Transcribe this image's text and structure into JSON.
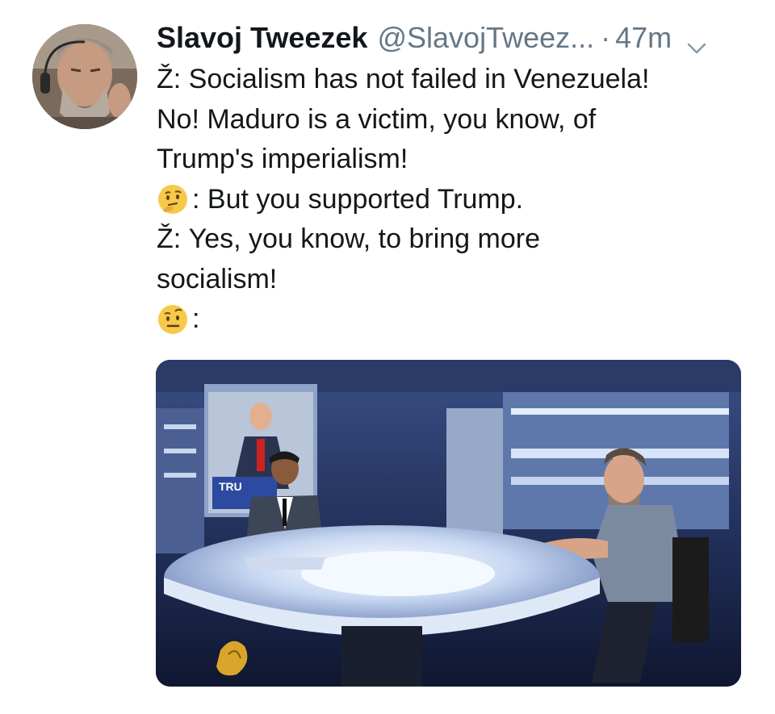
{
  "tweet": {
    "display_name": "Slavoj Tweezek",
    "handle": "@SlavojTweez...",
    "separator": "·",
    "timestamp": "47m",
    "caret_icon": "chevron-down-icon",
    "avatar_icon": "user-avatar",
    "lines": [
      {
        "speaker": "Ž:",
        "text": "Socialism has not failed in Venezuela!"
      },
      {
        "text": "No! Maduro is a victim, you know, of"
      },
      {
        "text": "Trump's imperialism!"
      },
      {
        "speaker_icon": "thinking-face-emoji",
        "text": ": But you supported Trump."
      },
      {
        "speaker": "Ž:",
        "text": "Yes, you know, to bring more"
      },
      {
        "text": "socialism!"
      },
      {
        "speaker_icon": "raised-eyebrow-face-emoji",
        "text": ":"
      }
    ],
    "media": {
      "description_icon": "tv-studio-photo",
      "screen_text": "TRU"
    }
  },
  "colors": {
    "text": "#14171a",
    "secondary": "#657786",
    "emoji_yellow": "#f7c948"
  }
}
